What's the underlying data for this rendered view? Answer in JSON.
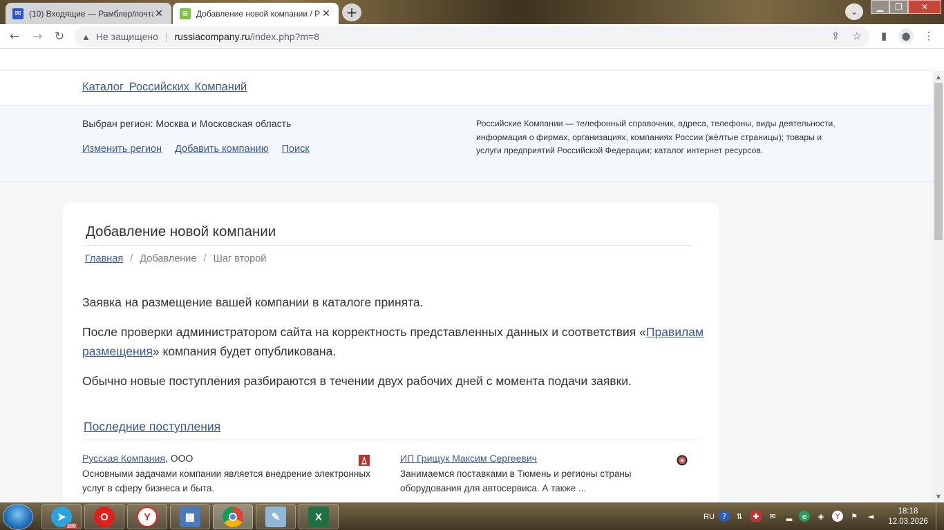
{
  "browser": {
    "tabs": [
      {
        "title": "(10) Входящие — Рамблер/почта",
        "favicon": "mail-icon",
        "close": "✕"
      },
      {
        "title": "Добавление новой компании / Р",
        "favicon": "site-logo-icon",
        "close": "✕"
      }
    ],
    "new_tab": "+",
    "omnibox": {
      "security_label": "Не защищено",
      "url_host": "russiacompany.ru",
      "url_path": "/index.php?m=8"
    }
  },
  "site": {
    "header_link": "Каталог  Российских  Компаний",
    "region_text": "Выбран регион: Москва и Московская область",
    "region_links": {
      "change": "Изменить регион",
      "add": "Добавить компанию",
      "search": "Поиск"
    },
    "description": "Российские Компании — телефонный справочник, адреса, телефоны, виды деятельности, информация о фирмах, организациях, компаниях России (жёлтые страницы); товары и услуги предприятий Российской Федерации; каталог интернет ресурсов."
  },
  "content": {
    "title": "Добавление новой компании",
    "breadcrumbs": {
      "home": "Главная",
      "sep": "/",
      "step1": "Добавление",
      "step2": "Шаг второй"
    },
    "para1": "Заявка на размещение вашей компании в каталоге принята.",
    "para2_before": "После проверки администратором сайта на корректность представленных данных и соответствия «",
    "para2_link": "Правилам размещения",
    "para2_after": "» компания будет опубликована.",
    "para3": "Обычно новые поступления разбираются в течении двух рабочих дней с момента подачи заявки.",
    "latest_heading": "Последние поступления",
    "entries": [
      {
        "name": "Русская Компания",
        "suffix": ", ООО",
        "desc": "Основными задачами компании является внедрение электронных услуг в сферу бизнеса и быта."
      },
      {
        "name": "ИП Грищук Максим Сергеевич",
        "suffix": "",
        "desc": "Занимаемся поставками в Тюмень и регионы страны оборудования для автосервиса. А также ..."
      }
    ]
  },
  "taskbar": {
    "telegram_badge": "389",
    "lang": "RU",
    "time": "18:18",
    "date": "12.03.2026"
  },
  "colors": {
    "link": "#3a57a4",
    "region_band": "#f2f8fc",
    "page_bg": "#f6f6f6"
  }
}
